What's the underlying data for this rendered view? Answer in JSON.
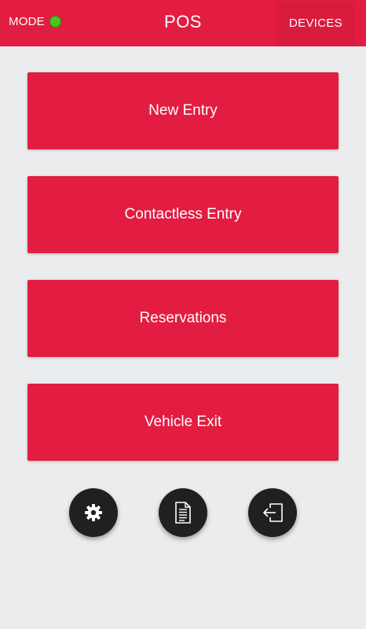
{
  "header": {
    "mode_label": "MODE",
    "mode_status_color": "#4ac524",
    "title": "POS",
    "devices_label": "DEVICES"
  },
  "menu": {
    "new_entry": "New Entry",
    "contactless_entry": "Contactless Entry",
    "reservations": "Reservations",
    "vehicle_exit": "Vehicle Exit"
  },
  "actions": [
    {
      "icon": "gear-icon"
    },
    {
      "icon": "document-icon"
    },
    {
      "icon": "logout-icon"
    }
  ],
  "colors": {
    "primary": "#e21d41",
    "background": "#ebecee",
    "fab": "#202020"
  }
}
